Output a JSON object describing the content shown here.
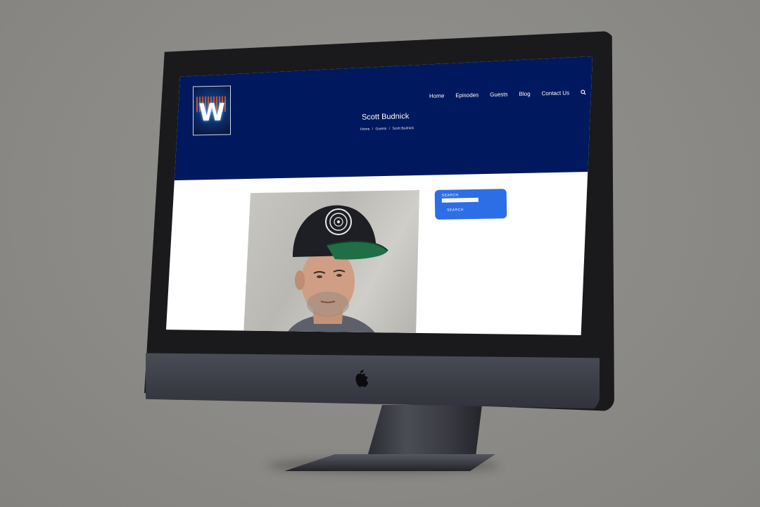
{
  "nav": {
    "items": [
      "Home",
      "Episodes",
      "Guests",
      "Blog",
      "Contact Us"
    ],
    "search_icon": "search-icon"
  },
  "logo": {
    "letter": "W",
    "icon": "podcast-logo"
  },
  "page": {
    "title": "Scott Budnick"
  },
  "breadcrumb": {
    "items": [
      "Home",
      "/",
      "Guests",
      "/",
      "Scott Budnick"
    ]
  },
  "sidebar": {
    "search_label": "SEARCH",
    "search_value": "",
    "search_button": "SEARCH"
  },
  "colors": {
    "header_bg": "#00195e",
    "search_widget_bg": "#2d6ee6",
    "background": "#8c8b87",
    "device_body": "#1a1a1c"
  },
  "device": {
    "logo_icon": "apple-icon"
  }
}
